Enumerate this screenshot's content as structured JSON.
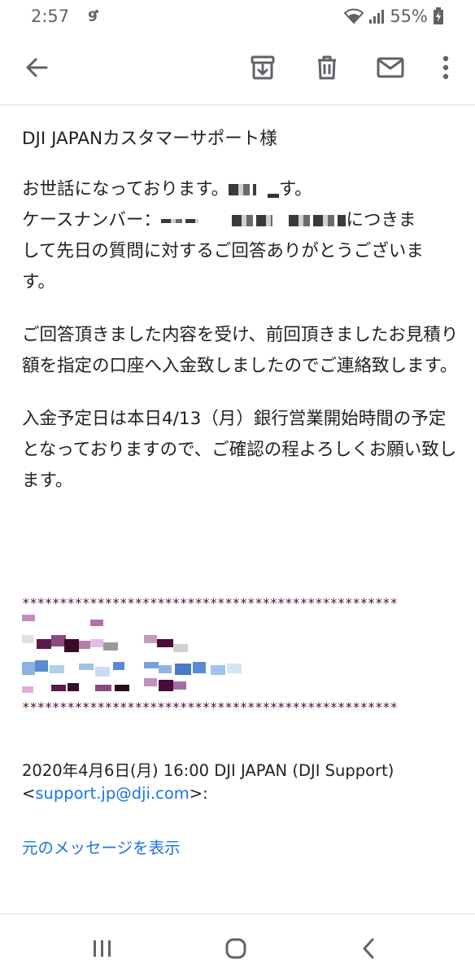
{
  "status_bar": {
    "time": "2:57",
    "battery": "55%",
    "icons": [
      "wifi-icon",
      "signal-icon",
      "battery-charging-icon"
    ]
  },
  "app_bar": {
    "icons": [
      "back-arrow-icon",
      "archive-icon",
      "delete-icon",
      "mark-unread-icon",
      "more-vert-icon"
    ]
  },
  "email": {
    "salutation": "DJI JAPANカスタマーサポート様",
    "p1_line1_prefix": "お世話になっております。",
    "p1_line1_suffix": "す。",
    "p1_line2_prefix": "ケースナンバー：",
    "p1_line2_suffix": "につきま",
    "p1_line3": "して先日の質問に対するご回答ありがとうございま",
    "p1_line4": "す。",
    "p2": "ご回答頂きました内容を受け、前回頂きましたお見積り額を指定の口座へ入金致しましたのでご連絡致します。",
    "p3": "入金予定日は本日4/13（月）銀行営業開始時間の予定となっておりますので、ご確認の程よろしくお願い致します。",
    "stars": "**************************************************",
    "quote_header_prefix": "2020年4月6日(月) 16:00 DJI JAPAN (DJI Support)",
    "quote_open": "<",
    "quote_email": "support.jp@dji.com",
    "quote_close": ">:",
    "show_original": "元のメッセージを表示"
  },
  "colors": {
    "link": "#1a73e8",
    "stars": "#4a0a3a",
    "icon": "#5f6368"
  }
}
